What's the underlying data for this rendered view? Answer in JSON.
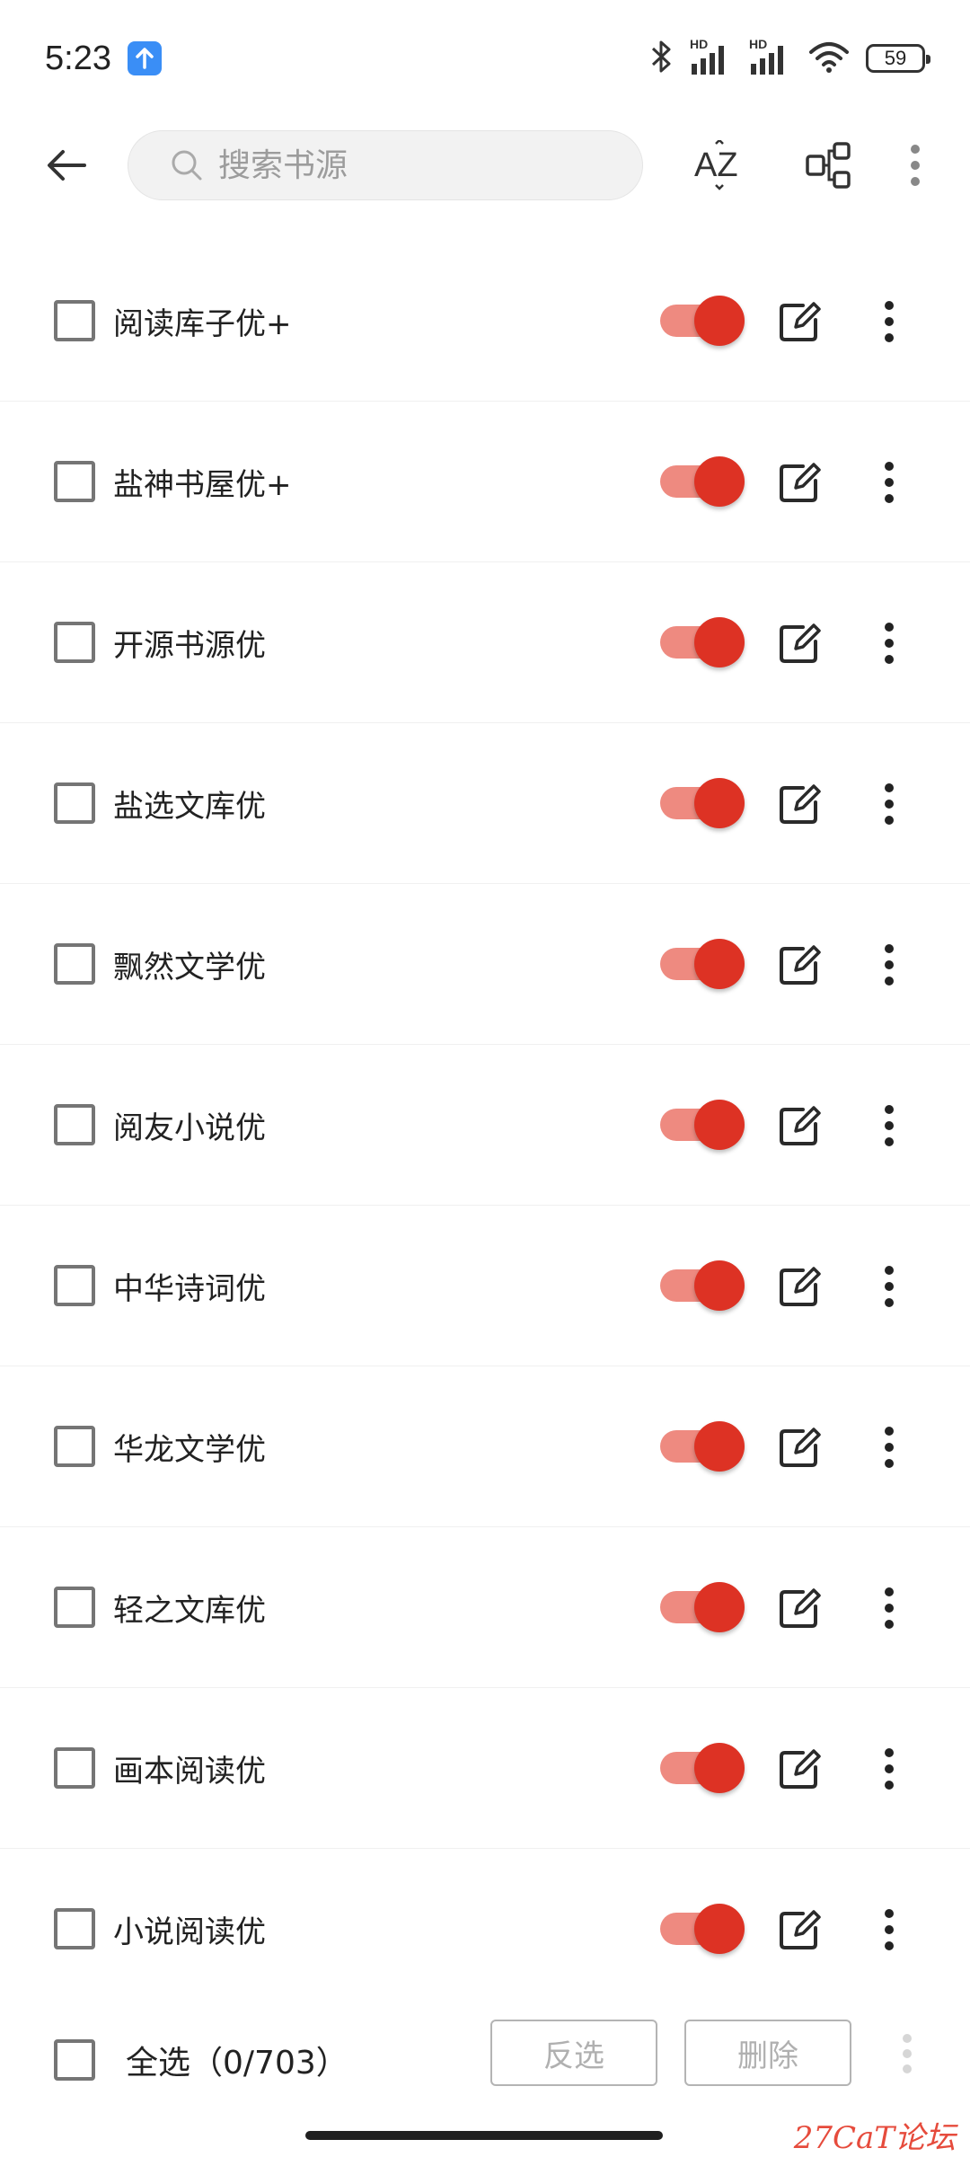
{
  "status_bar": {
    "time": "5:23",
    "network_1": "HD",
    "network_2": "HD",
    "battery": "59"
  },
  "toolbar": {
    "search_placeholder": "搜索书源",
    "sort_label": "AZ"
  },
  "sources": [
    {
      "name": "阅读库子优+",
      "enabled": true,
      "checked": false
    },
    {
      "name": "盐神书屋优+",
      "enabled": true,
      "checked": false
    },
    {
      "name": "开源书源优",
      "enabled": true,
      "checked": false
    },
    {
      "name": "盐选文库优",
      "enabled": true,
      "checked": false
    },
    {
      "name": "飘然文学优",
      "enabled": true,
      "checked": false
    },
    {
      "name": "阅友小说优",
      "enabled": true,
      "checked": false
    },
    {
      "name": "中华诗词优",
      "enabled": true,
      "checked": false
    },
    {
      "name": "华龙文学优",
      "enabled": true,
      "checked": false
    },
    {
      "name": "轻之文库优",
      "enabled": true,
      "checked": false
    },
    {
      "name": "画本阅读优",
      "enabled": true,
      "checked": false
    },
    {
      "name": "小说阅读优",
      "enabled": true,
      "checked": false
    }
  ],
  "bottom_bar": {
    "select_all_label": "全选（0/703）",
    "invert_label": "反选",
    "delete_label": "删除"
  },
  "watermark": "27CaT论坛",
  "colors": {
    "switch_thumb": "#dd3224",
    "switch_track": "#ee8a80",
    "upload_badge": "#3a8ef6"
  }
}
